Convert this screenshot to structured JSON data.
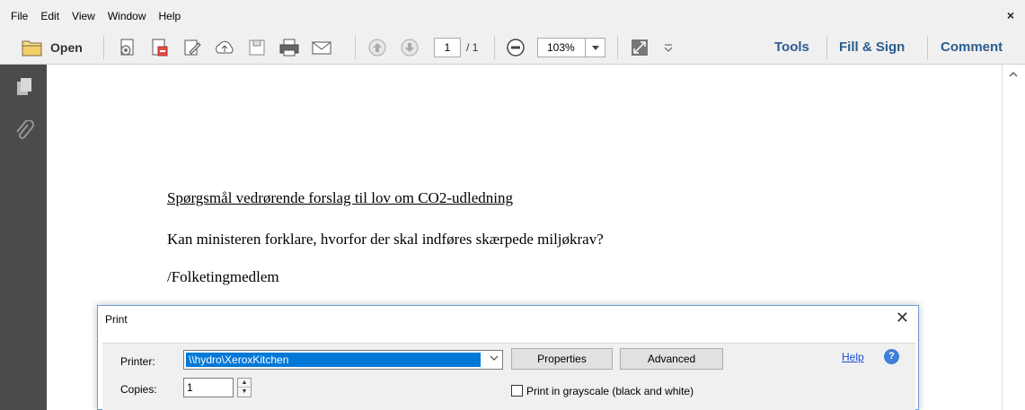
{
  "menu": {
    "items": [
      "File",
      "Edit",
      "View",
      "Window",
      "Help"
    ],
    "close_glyph": "×"
  },
  "toolbar": {
    "open_label": "Open",
    "current_page": "1",
    "page_total": "/ 1",
    "zoom": "103%",
    "right_tabs": [
      "Tools",
      "Fill & Sign",
      "Comment"
    ],
    "icons": [
      "open-folder-icon",
      "create-pdf-icon",
      "export-pdf-icon",
      "edit-pdf-icon",
      "upload-cloud-icon",
      "save-icon",
      "print-icon",
      "email-icon",
      "previous-page-icon",
      "next-page-icon",
      "zoom-out-icon",
      "fit-page-icon",
      "more-tools-icon"
    ]
  },
  "document": {
    "heading": "Spørgsmål vedrørende forslag til lov om CO2-udledning",
    "question": "Kan ministeren forklare, hvorfor der skal indføres skærpede miljøkrav?",
    "author": "/Folketingmedlem"
  },
  "dialog": {
    "title": "Print",
    "close_glyph": "✕",
    "printer_label": "Printer:",
    "printer_value": "\\\\hydro\\XeroxKitchen",
    "properties_label": "Properties",
    "advanced_label": "Advanced",
    "help_label": "Help",
    "help_glyph": "?",
    "copies_label": "Copies:",
    "copies_value": "1",
    "grayscale_label": "Print in grayscale (black and white)",
    "grayscale_checked": false
  },
  "colors": {
    "accent": "#2a5d8f",
    "selection": "#0078d7",
    "nav_pane": "#4b4b4b"
  }
}
